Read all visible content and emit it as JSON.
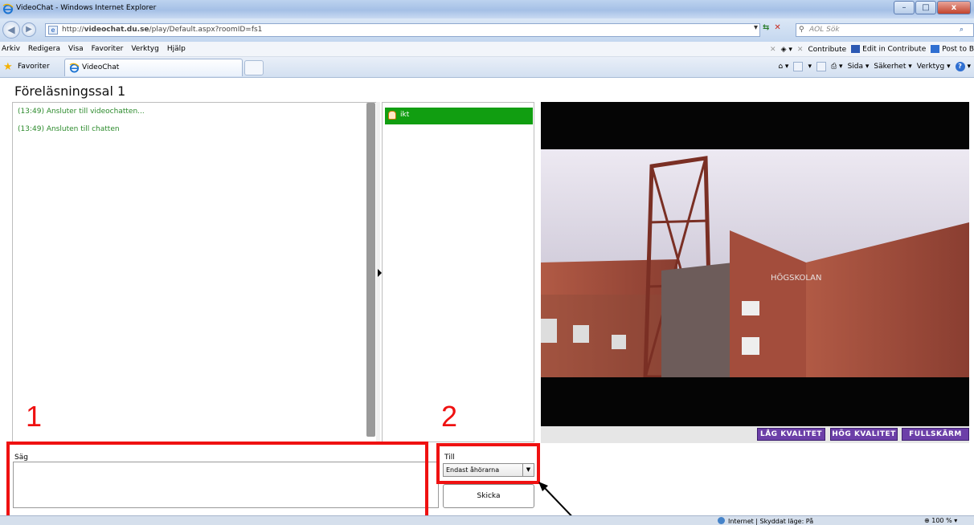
{
  "window": {
    "title": "VideoChat - Windows Internet Explorer",
    "controls": {
      "minimize": "–",
      "maximize": "□",
      "close": "x"
    }
  },
  "address_bar": {
    "url_prefix": "http://",
    "url_host": "videochat.du.se",
    "url_path": "/play/Default.aspx?roomID=fs1",
    "search_placeholder": "AOL Sök"
  },
  "menu": {
    "items": [
      "Arkiv",
      "Redigera",
      "Visa",
      "Favoriter",
      "Verktyg",
      "Hjälp"
    ],
    "right": {
      "contribute": "Contribute",
      "edit_in_contribute": "Edit in Contribute",
      "post_to": "Post to B"
    }
  },
  "tabs": {
    "favorites_label": "Favoriter",
    "active_tab": "VideoChat"
  },
  "command_bar": {
    "sida": "Sida ▾",
    "sakerhet": "Säkerhet ▾",
    "verktyg": "Verktyg ▾"
  },
  "page": {
    "title": "Föreläsningssal 1"
  },
  "chat": {
    "messages": [
      {
        "text": "(13:49) Ansluter till videochatten..."
      },
      {
        "text": "(13:49) Ansluten till chatten"
      }
    ]
  },
  "users": [
    {
      "name": "ikt"
    }
  ],
  "video": {
    "quality_low": "LÅG KVALITET",
    "quality_high": "HÖG KVALITET",
    "fullscreen": "FULLSKÄRM",
    "sign_text": "HÖGSKOLAN"
  },
  "compose": {
    "say_label": "Säg",
    "to_label": "Till",
    "recipient_selected": "Endast åhörarna",
    "send_label": "Skicka"
  },
  "annotations": {
    "label_1": "1",
    "label_2": "2",
    "color": "#ef1111"
  },
  "status": {
    "zone": "Internet | Skyddat läge: På",
    "zoom": "100 %"
  },
  "colors": {
    "user_highlight": "#119e11",
    "chat_text": "#2b8a2b",
    "quality_button": "#6c3fa8"
  }
}
